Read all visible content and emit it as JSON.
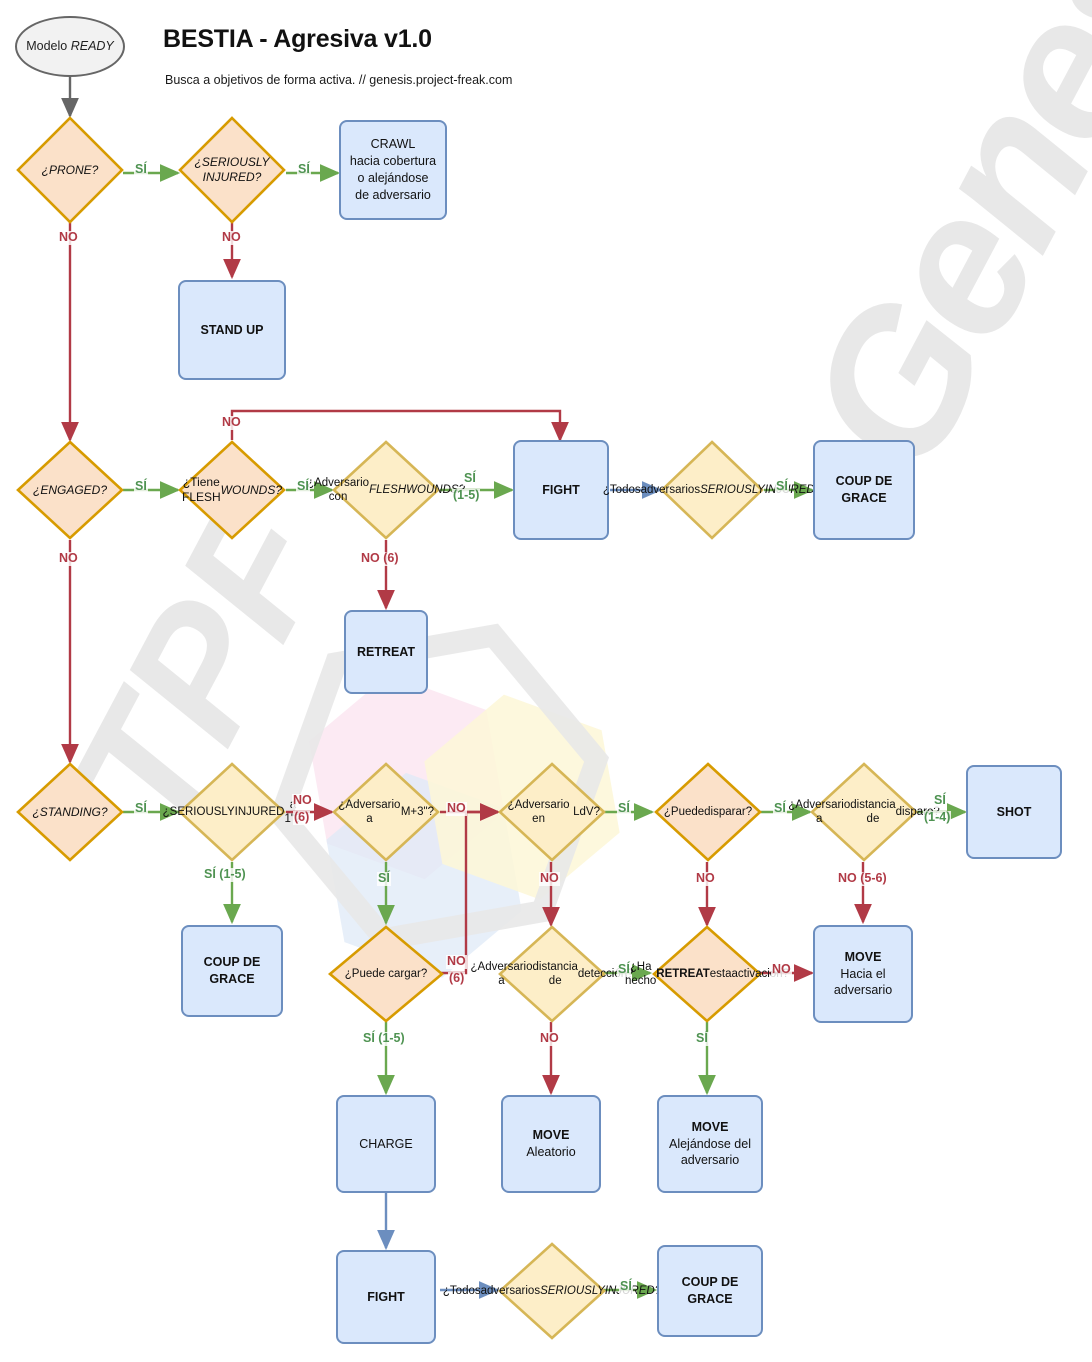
{
  "header": {
    "title": "BESTIA - Agresiva v1.0",
    "subtitle": "Busca a objetivos de forma activa. // genesis.project-freak.com"
  },
  "watermark": {
    "primary": "Genesis",
    "secondary": "TPF"
  },
  "palette": {
    "decision_orange_fill": "#fbe1c9",
    "decision_yellow_fill": "#fdeec8",
    "decision_stroke": "#d79b00",
    "process_fill": "#dae8fc",
    "process_stroke": "#6c8ebf",
    "start_fill": "#f2f2f2",
    "start_stroke": "#666666",
    "yes_color": "#4f9352",
    "no_color": "#b13a46",
    "neutral_arrow": "#6c8ebf",
    "watermark_gray": "#e8e8e8"
  },
  "nodes": {
    "start": {
      "label": "Modelo READY",
      "plain": "Modelo ",
      "italic": "READY"
    },
    "prone": {
      "label": "¿PRONE?"
    },
    "seriously_injured_1": {
      "line1": "¿SERIOUSLY",
      "line2": "INJURED?"
    },
    "crawl": {
      "title": "CRAWL",
      "line2": "hacia cobertura",
      "line3": "o alejándose",
      "line4": "de adversario"
    },
    "stand_up": {
      "title": "STAND UP"
    },
    "engaged": {
      "label": "¿ENGAGED?"
    },
    "tiene_flesh_wounds": {
      "line1": "¿Tiene FLESH",
      "line2": "WOUNDS?"
    },
    "adversario_flesh_wounds": {
      "line1": "¿Adversario con",
      "line2": "FLESH",
      "line3": "WOUNDS?"
    },
    "fight_mid": {
      "title": "FIGHT"
    },
    "todos_si_mid": {
      "line1": "¿Todos",
      "line2": "adversarios",
      "line3": "SERIOUSLY",
      "line4": "INJURED?"
    },
    "coup_mid": {
      "line1": "COUP DE",
      "line2": "GRACE"
    },
    "retreat": {
      "title": "RETREAT"
    },
    "standing": {
      "label": "¿STANDING?"
    },
    "seriously_injured_1in": {
      "line1": "¿SERIOUSLY",
      "line2": "INJURED",
      "line3": "a 1\"?"
    },
    "coup_left": {
      "line1": "COUP DE",
      "line2": "GRACE"
    },
    "adversario_m3": {
      "line1": "¿Adversario a",
      "line2": "M+3\"?"
    },
    "puede_cargar": {
      "label": "¿Puede cargar?"
    },
    "charge": {
      "title": "CHARGE"
    },
    "adversario_ldv": {
      "line1": "¿Adversario en",
      "line2": "LdV?"
    },
    "adversario_deteccion": {
      "line1": "¿Adversario a",
      "line2": "distancia de",
      "line3": "detección?"
    },
    "move_aleatorio": {
      "title": "MOVE",
      "line2": "Aleatorio"
    },
    "puede_disparar": {
      "line1": "¿Puede",
      "line2": "disparar?"
    },
    "ha_hecho_retreat": {
      "line1": "¿Ha hecho",
      "line2pre": "",
      "line2bold": "RETREAT",
      "line2post": " esta",
      "line3": "activación?"
    },
    "move_alejandose": {
      "title": "MOVE",
      "line2": "Alejándose del",
      "line3": "adversario"
    },
    "adversario_distancia_disparo": {
      "line1": "¿Adversario a",
      "line2": "distancia de",
      "line3": "disparo?"
    },
    "shot": {
      "title": "SHOT"
    },
    "move_hacia": {
      "title": "MOVE",
      "line2": "Hacia el",
      "line3": "adversario"
    },
    "fight_bottom": {
      "title": "FIGHT"
    },
    "todos_si_bottom": {
      "line1": "¿Todos",
      "line2": "adversarios",
      "line3": "SERIOUSLY",
      "line4": "INJURED?"
    },
    "coup_bottom": {
      "line1": "COUP DE",
      "line2": "GRACE"
    }
  },
  "edge_labels": {
    "prone_yes": "SÍ",
    "prone_no": "NO",
    "si1_yes": "SÍ",
    "si1_no": "NO",
    "engaged_yes": "SÍ",
    "engaged_no": "NO",
    "tiene_fw_yes": "SÍ",
    "tiene_fw_no": "NO",
    "adv_fw_yes": "SÍ",
    "adv_fw_yes_roll": "(1-5)",
    "adv_fw_no": "NO (6)",
    "todos_mid_yes": "SÍ",
    "standing_yes": "SÍ",
    "si1in_yes": "SÍ (1-5)",
    "si1in_no": "NO",
    "si1in_no_roll": "(6)",
    "m3_yes": "SÍ",
    "m3_no": "NO",
    "cargar_yes": "SÍ (1-5)",
    "cargar_no": "NO",
    "cargar_no_roll": "(6)",
    "ldv_yes": "SÍ",
    "ldv_no": "NO",
    "deteccion_yes": "SÍ",
    "deteccion_no": "NO",
    "disparar_yes": "SÍ",
    "disparar_no": "NO",
    "retreat_q_yes": "SÍ",
    "retreat_q_no": "NO",
    "disparo_yes": "SÍ",
    "disparo_yes_roll": "(1-4)",
    "disparo_no": "NO (5-6)",
    "todos_bottom_yes": "SÍ"
  }
}
